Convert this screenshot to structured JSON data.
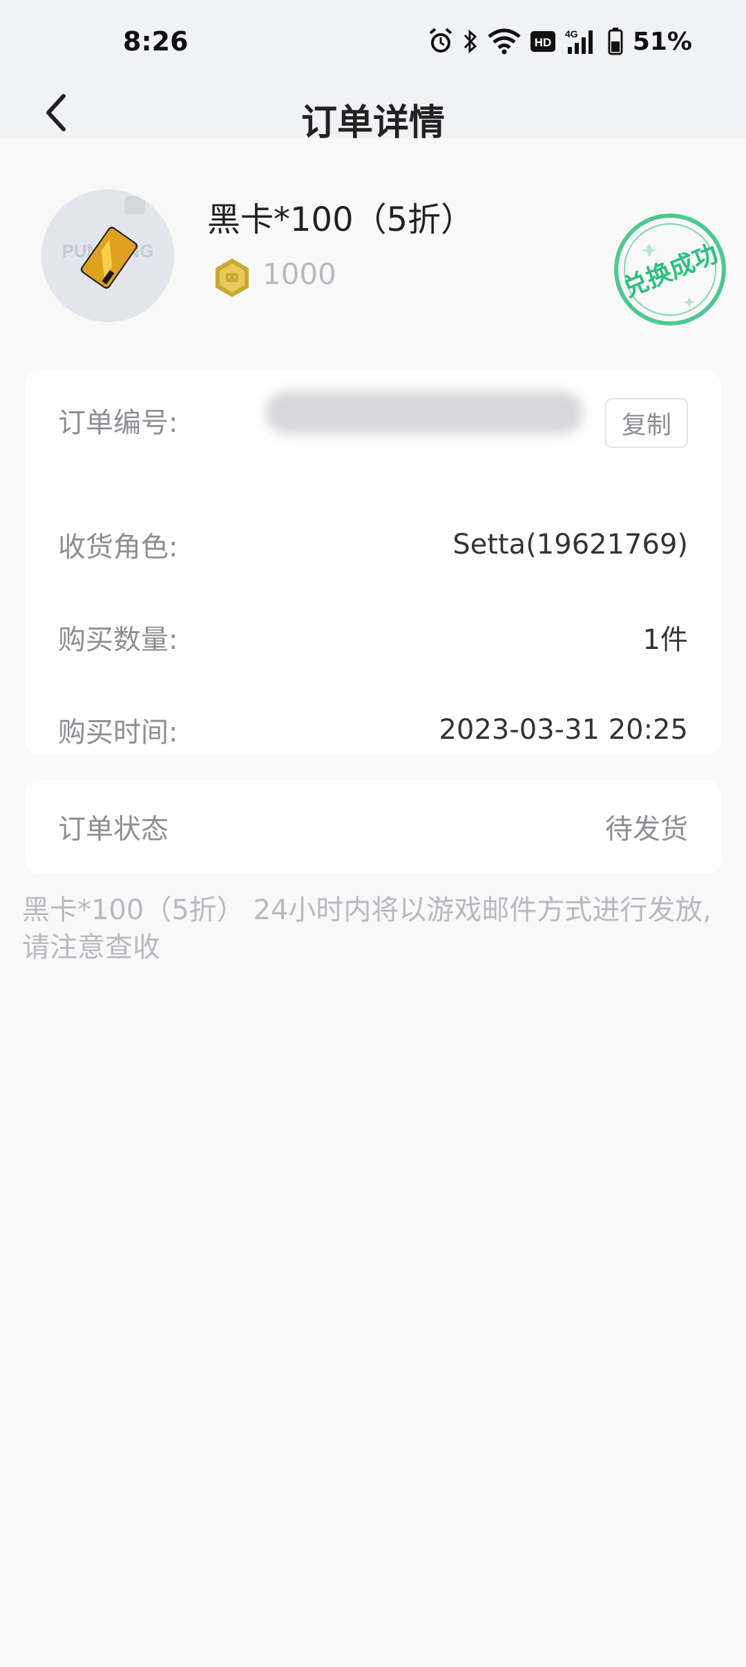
{
  "status_bar": {
    "time": "8:26",
    "battery": "51%",
    "icons": [
      "alarm-icon",
      "bluetooth-icon",
      "wifi-icon",
      "hd-icon",
      "signal-4g-icon",
      "battery-icon"
    ]
  },
  "nav": {
    "title": "订单详情",
    "back_icon": "chevron-left-icon"
  },
  "product": {
    "name": "黑卡*100（5折）",
    "price": "1000",
    "stamp_text": "兑换成功",
    "thumb_watermark": "PUNKONG",
    "stamp_color": "#2fbf7f"
  },
  "details": {
    "order_no_label": "订单编号:",
    "copy_label": "复制",
    "role_label": "收货角色:",
    "role_value": "Setta(19621769)",
    "qty_label": "购买数量:",
    "qty_value": "1件",
    "time_label": "购买时间:",
    "time_value": "2023-03-31 20:25"
  },
  "status": {
    "label": "订单状态",
    "value": "待发货"
  },
  "notice": {
    "line1": "黑卡*100（5折） 24小时内将以游戏邮件方式进行发放,",
    "line2": "请注意查收"
  }
}
